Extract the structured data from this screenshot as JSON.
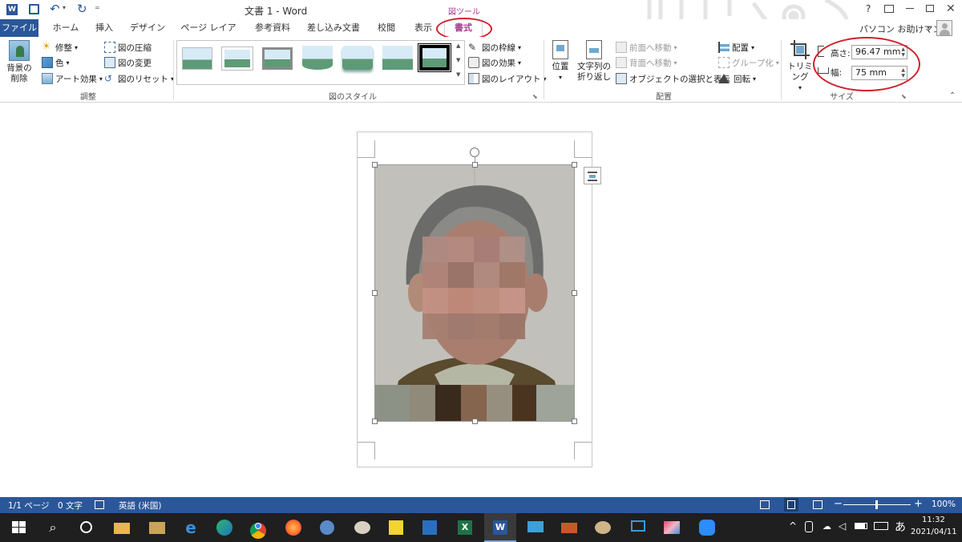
{
  "title_bar": {
    "doc_title": "文書 1 - Word",
    "picture_tools": "図ツール",
    "help": "?",
    "user": "パソコン お助けマン"
  },
  "tabs": [
    "ファイル",
    "ホーム",
    "挿入",
    "デザイン",
    "ページ レイアウト",
    "参考資料",
    "差し込み文書",
    "校閲",
    "表示",
    "書式"
  ],
  "ribbon": {
    "adjust": {
      "remove_bg": "背景の\n削除",
      "corrections": "修整",
      "color": "色",
      "artistic": "アート効果",
      "compress": "図の圧縮",
      "change": "図の変更",
      "reset": "図のリセット",
      "label": "調整"
    },
    "styles": {
      "border": "図の枠線",
      "effects": "図の効果",
      "layout": "図のレイアウト",
      "label": "図のスタイル"
    },
    "arrange": {
      "position": "位置",
      "wrap": "文字列の\n折り返し",
      "forward": "前面へ移動",
      "backward": "背面へ移動",
      "selection": "オブジェクトの選択と表示",
      "align": "配置",
      "group": "グループ化",
      "rotate": "回転",
      "label": "配置"
    },
    "size": {
      "crop": "トリミング",
      "height_label": "高さ:",
      "height_value": "96.47 mm",
      "width_label": "幅:",
      "width_value": "75 mm",
      "label": "サイズ"
    }
  },
  "status": {
    "page": "1/1 ページ",
    "words": "0 文字",
    "language": "英語 (米国)",
    "zoom": "100%"
  },
  "taskbar": {
    "ime": "あ",
    "time": "11:32",
    "date": "2021/04/11"
  },
  "colors": {
    "word_blue": "#2b579a",
    "picture_tools_accent": "#a33e8f",
    "annotation_red": "#d0202a"
  }
}
